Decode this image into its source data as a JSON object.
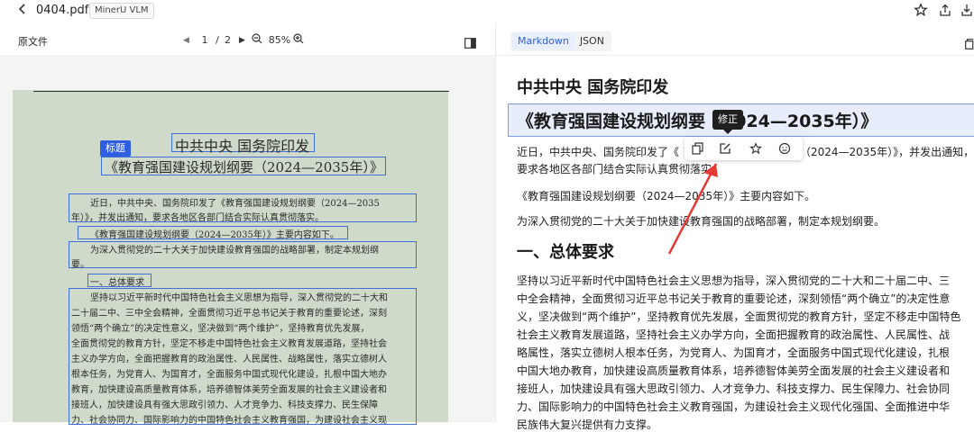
{
  "header": {
    "back_icon": "chevron-left-icon",
    "filename": "0404.pdf",
    "tag": "MinerU VLM",
    "actions": [
      "star-icon",
      "share-icon",
      "download-icon"
    ]
  },
  "left": {
    "title": "原文件",
    "pager": {
      "current": "1",
      "sep": "/",
      "total": "2",
      "zoom": "85%"
    },
    "badge": "标题",
    "page_lines": {
      "l1": "中共中央  国务院印发",
      "l2": "《教育强国建设规划纲要（2024—2035年）》",
      "l3": "近日，中共中央、国务院印发了《教育强国建设规划纲要（2024—2035",
      "l4": "年）》，并发出通知，要求各地区各部门结合实际认真贯彻落实。",
      "l5": "《教育强国建设规划纲要（2024—2035年）》主要内容如下。",
      "l6": "为深入贯彻党的二十大关于加快建设教育强国的战略部署，制定本规划纲",
      "l7": "要。",
      "l8": "一、总体要求",
      "l9": "坚持以习近平新时代中国特色社会主义思想为指导，深入贯彻党的二十大和",
      "l10": "二十届二中、三中全会精神，全面贯彻习近平总书记关于教育的重要论述，深刻",
      "l11": "领悟“两个确立”的决定性意义，坚决做到“两个维护”，坚持教育优先发展，",
      "l12": "全面贯彻党的教育方针，坚定不移走中国特色社会主义教育发展道路，坚持社会",
      "l13": "主义办学方向，全面把握教育的政治属性、人民属性、战略属性，落实立德树人",
      "l14": "根本任务，为党育人、为国育才，全面服务中国式现代化建设，扎根中国大地办",
      "l15": "教育，加快建设高质量教育体系，培养德智体美劳全面发展的社会主义建设者和",
      "l16": "接班人，加快建设具有强大思政引领力、人才竞争力、科技支撑力、民生保障",
      "l17": "力、社会协同力、国际影响力的中国特色社会主义教育强国，为建设社会主义现"
    }
  },
  "right": {
    "tabs": [
      "Markdown",
      "JSON"
    ],
    "h2": "中共中央 国务院印发",
    "h1": "《教育强国建设规划纲要（2024—2035年）》",
    "tooltip": "修正",
    "p1a": "近日，中共中央、国务院印发了《",
    "p1b": "（2024—2035年）》，并发出通知，",
    "p1c": "要求各地区各部门结合实际认真贯彻落实。",
    "p2": "《教育强国建设规划纲要（2024—2035年）》主要内容如下。",
    "p3": "为深入贯彻党的二十大关于加快建设教育强国的战略部署，制定本规划纲要。",
    "h3": "一、总体要求",
    "body": [
      "坚持以习近平新时代中国特色社会主义思想为指导，深入贯彻党的二十大和二十届二中、三",
      "中全会精神，全面贯彻习近平总书记关于教育的重要论述，深刻领悟“两个确立”的决定性意",
      "义，坚决做到“两个维护”，坚持教育优先发展，全面贯彻党的教育方针，坚定不移走中国特色",
      "社会主义教育发展道路，坚持社会主义办学方向，全面把握教育的政治属性、人民属性、战",
      "略属性，落实立德树人根本任务，为党育人、为国育才，全面服务中国式现代化建设，扎根",
      "中国大地办教育，加快建设高质量教育体系，培养德智体美劳全面发展的社会主义建设者和",
      "接班人，加快建设具有强大思政引领力、人才竞争力、科技支撑力、民生保障力、社会协同",
      "力、国际影响力的中国特色社会主义教育强国，为建设社会主义现代化强国、全面推进中华",
      "民族伟大复兴提供有力支撑。"
    ]
  },
  "colors": {
    "accent": "#2f5fe0",
    "block_border": "#3f6fd8",
    "page_bg": "#cfdacb",
    "arrow": "#e53935"
  }
}
